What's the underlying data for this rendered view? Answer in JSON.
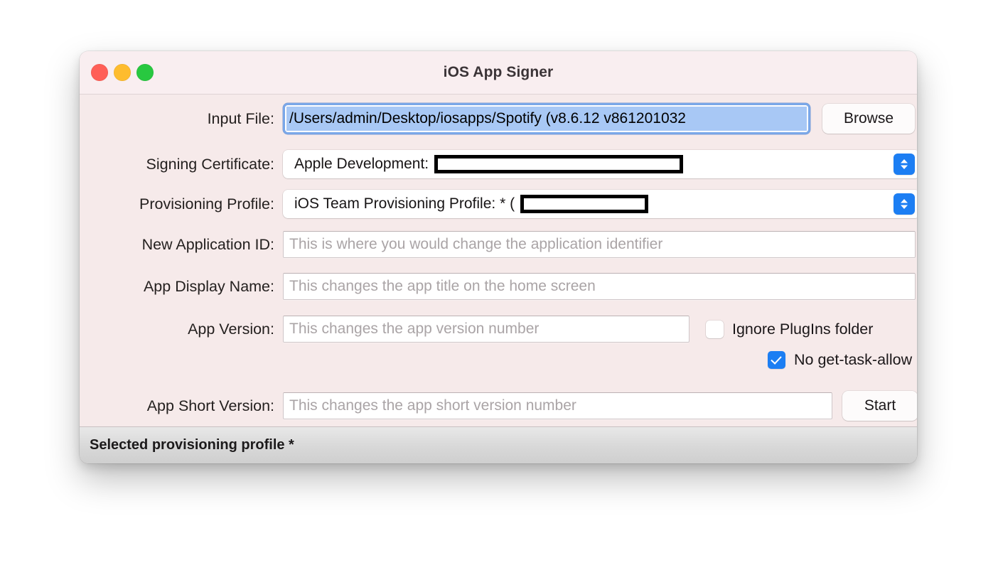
{
  "window": {
    "title": "iOS App Signer",
    "traffic_lights": [
      {
        "name": "close",
        "color": "#ff5f57"
      },
      {
        "name": "minimize",
        "color": "#febc2e"
      },
      {
        "name": "zoom",
        "color": "#28c840"
      }
    ]
  },
  "form": {
    "input_file": {
      "label": "Input File:",
      "value": "/Users/admin/Desktop/iosapps/Spotify (v8.6.12 v861201032 ",
      "browse_label": "Browse"
    },
    "signing_certificate": {
      "label": "Signing Certificate:",
      "value": "Apple Development:",
      "redacted": true
    },
    "provisioning_profile": {
      "label": "Provisioning Profile:",
      "value": "iOS Team Provisioning Profile: * (",
      "redacted": true
    },
    "new_application_id": {
      "label": "New Application ID:",
      "value": "",
      "placeholder": "This is where you would change the application identifier"
    },
    "app_display_name": {
      "label": "App Display Name:",
      "value": "",
      "placeholder": "This changes the app title on the home screen"
    },
    "app_version": {
      "label": "App Version:",
      "value": "",
      "placeholder": "This changes the app version number"
    },
    "app_short_version": {
      "label": "App Short Version:",
      "value": "",
      "placeholder": "This changes the app short version number"
    }
  },
  "options": {
    "ignore_plugins": {
      "label": "Ignore PlugIns folder",
      "checked": false
    },
    "no_get_task_allow": {
      "label": "No get-task-allow",
      "checked": true
    }
  },
  "actions": {
    "start_label": "Start"
  },
  "status": {
    "text": "Selected provisioning profile *"
  },
  "colors": {
    "accent": "#1c7ef3",
    "window_bg": "#f6eaea",
    "titlebar_bg": "#f9eef0",
    "selection": "#a8c8f5",
    "focus_ring": "#7aa7e8"
  }
}
